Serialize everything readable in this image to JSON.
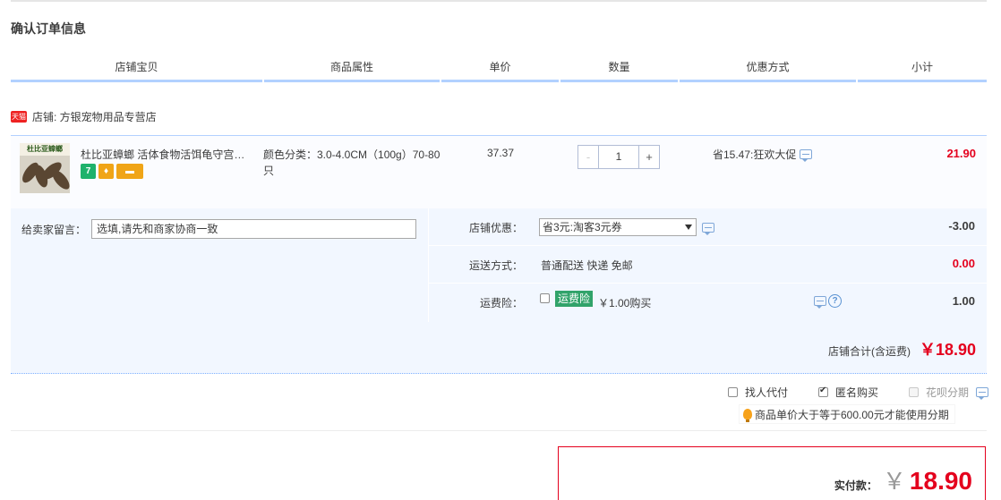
{
  "page_title": "确认订单信息",
  "columns": [
    "店铺宝贝",
    "商品属性",
    "单价",
    "数量",
    "优惠方式",
    "小计"
  ],
  "shop": {
    "badge": "天猫",
    "label": "店铺: 方银宠物用品专营店"
  },
  "item": {
    "thumb_text": "杜比亚蟑螂",
    "title": "杜比亚蟑螂 活体食物活饵龟守宫蜥蜴",
    "attr": "颜色分类：3.0-4.0CM（100g）70-80只",
    "unit_price": "37.37",
    "quantity": "1",
    "minus": "-",
    "plus": "+",
    "discount": "省15.47:狂欢大促",
    "subtotal": "21.90",
    "service_icons": [
      {
        "name": "seven-day-return-icon",
        "text": "7",
        "color": "#1fb26b"
      },
      {
        "name": "guarantee-icon",
        "text": "♦",
        "color": "#f0a517"
      },
      {
        "name": "card-pay-icon",
        "text": "▬",
        "color": "#f0a517"
      }
    ]
  },
  "memo": {
    "label": "给卖家留言：",
    "placeholder": "选填,请先和商家协商一致"
  },
  "shop_discount": {
    "label": "店铺优惠：",
    "selected": "省3元:淘客3元券",
    "value": "-3.00"
  },
  "shipping": {
    "label": "运送方式：",
    "text": "普通配送 快递 免邮",
    "value": "0.00"
  },
  "insurance": {
    "label": "运费险：",
    "tag": "运费险",
    "price": "￥1.00购买",
    "help": "?",
    "value": "1.00"
  },
  "shop_total": {
    "label": "店铺合计(含运费)",
    "amount": "￥18.90"
  },
  "options": {
    "proxy_pay": "找人代付",
    "anonymous": "匿名购买",
    "huabei": "花呗分期"
  },
  "huabei_tip": "商品单价大于等于600.00元才能使用分期",
  "payment": {
    "label": "实付款：",
    "currency": "￥",
    "amount": "18.90"
  }
}
